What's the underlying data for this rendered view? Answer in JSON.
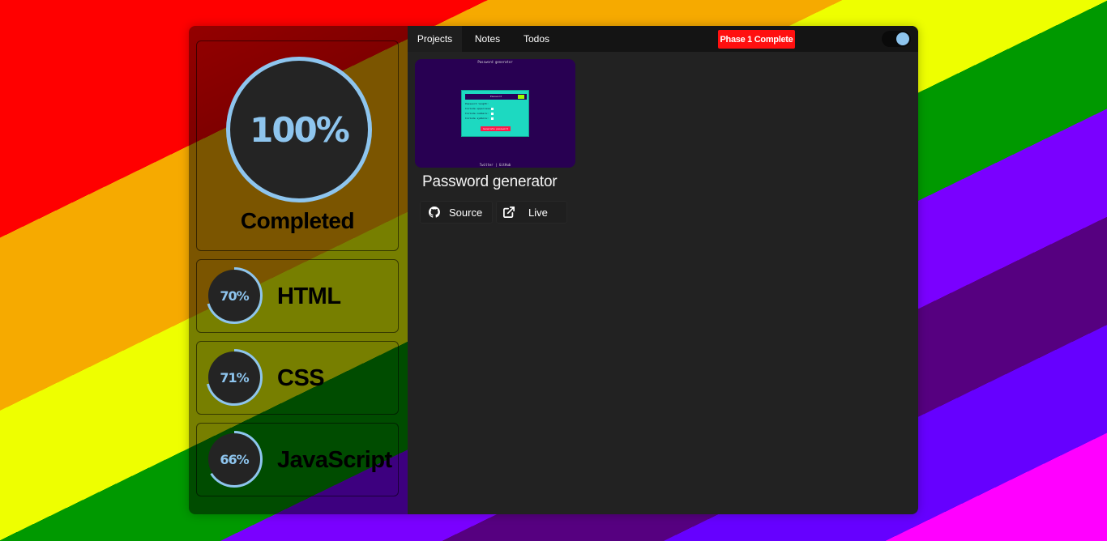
{
  "sidebar": {
    "overall": {
      "percent_label": "100%",
      "status": "Completed",
      "progress": 1.0
    },
    "skills": [
      {
        "percent_label": "70%",
        "name": "HTML",
        "progress": 0.7
      },
      {
        "percent_label": "71%",
        "name": "CSS",
        "progress": 0.71
      },
      {
        "percent_label": "66%",
        "name": "JavaScript",
        "progress": 0.66
      }
    ]
  },
  "topbar": {
    "tabs": [
      {
        "label": "Projects",
        "active": true
      },
      {
        "label": "Notes",
        "active": false
      },
      {
        "label": "Todos",
        "active": false
      }
    ],
    "badge": "Phase 1 Complete",
    "theme_toggle": {
      "on": true
    }
  },
  "projects": [
    {
      "title": "Password generator",
      "thumbnail": {
        "heading": "Password generator",
        "card_title": "Password",
        "rows": [
          "Password length:",
          "Include uppercase:",
          "Include numbers:",
          "Include symbols:"
        ],
        "button": "Generate password",
        "footer": "Twitter | GitHub"
      },
      "source_label": "Source",
      "live_label": "Live"
    }
  ],
  "colors": {
    "accent": "#8ec5ee",
    "badge": "#ff1010",
    "panel": "#222222",
    "topbar": "#141414"
  },
  "icons": {
    "source": "github-icon",
    "live": "external-link-icon"
  }
}
